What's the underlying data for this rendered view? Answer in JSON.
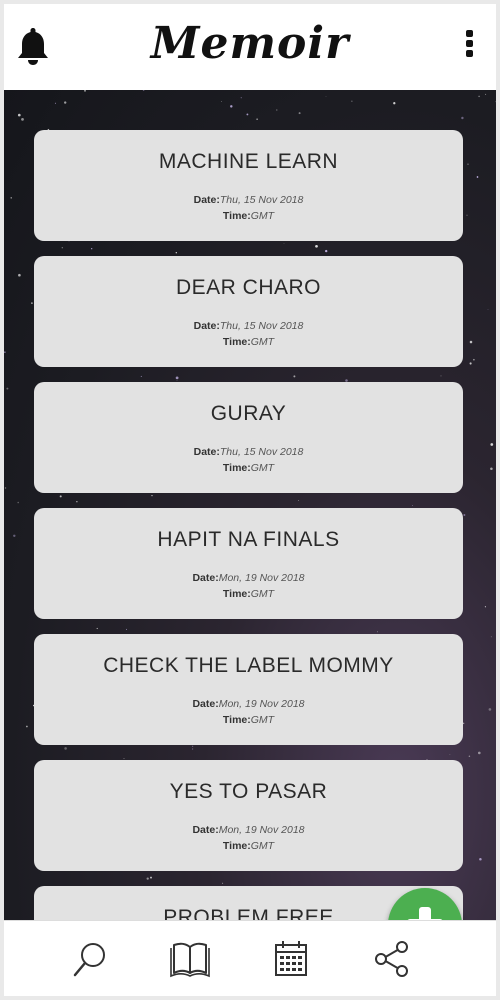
{
  "header": {
    "title": "Memoir",
    "left_icon": "bell-icon",
    "right_icon": "more-vertical-icon"
  },
  "entries": [
    {
      "title": "MACHINE LEARN",
      "date_label": "Date:",
      "date": "Thu, 15 Nov 2018",
      "time_label": "Time:",
      "time": "GMT"
    },
    {
      "title": "DEAR CHARO",
      "date_label": "Date:",
      "date": "Thu, 15 Nov 2018",
      "time_label": "Time:",
      "time": "GMT"
    },
    {
      "title": "GURAY",
      "date_label": "Date:",
      "date": "Thu, 15 Nov 2018",
      "time_label": "Time:",
      "time": "GMT"
    },
    {
      "title": "HAPIT NA FINALS",
      "date_label": "Date:",
      "date": "Mon, 19 Nov 2018",
      "time_label": "Time:",
      "time": "GMT"
    },
    {
      "title": "CHECK THE LABEL MOMMY",
      "date_label": "Date:",
      "date": "Mon, 19 Nov 2018",
      "time_label": "Time:",
      "time": "GMT"
    },
    {
      "title": "YES TO PASAR",
      "date_label": "Date:",
      "date": "Mon, 19 Nov 2018",
      "time_label": "Time:",
      "time": "GMT"
    },
    {
      "title": "PROBLEM FREE",
      "date_label": "",
      "date": "",
      "time_label": "",
      "time": ""
    }
  ],
  "fab": {
    "icon": "plus-icon",
    "color": "#4caf50"
  },
  "bottom_nav": [
    {
      "name": "search",
      "icon": "search-icon"
    },
    {
      "name": "journal",
      "icon": "book-icon"
    },
    {
      "name": "calendar",
      "icon": "calendar-icon"
    },
    {
      "name": "share",
      "icon": "share-icon"
    }
  ],
  "colors": {
    "card_bg": "#e2e2e2",
    "fab": "#4caf50",
    "background": "#1c1c22"
  }
}
